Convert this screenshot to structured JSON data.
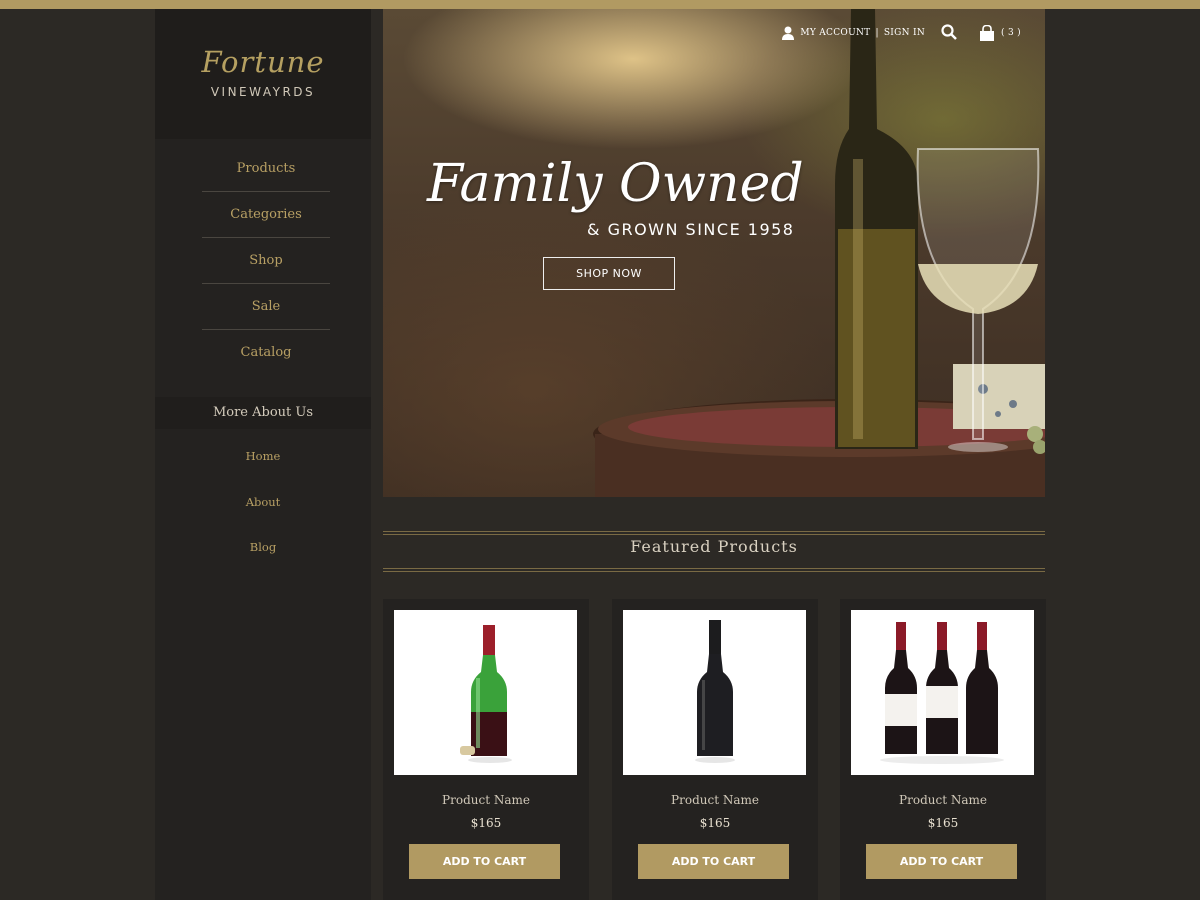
{
  "brand": {
    "script": "Fortune",
    "sub": "VINEWAYRDS"
  },
  "nav": [
    "Products",
    "Categories",
    "Shop",
    "Sale",
    "Catalog"
  ],
  "more": {
    "title": "More About Us",
    "items": [
      "Home",
      "About",
      "Blog"
    ]
  },
  "header": {
    "account": "MY ACCOUNT",
    "separator": "|",
    "signin": "SIGN IN",
    "cart_count": "( 3 )"
  },
  "hero": {
    "title": "Family Owned",
    "subtitle": "& GROWN SINCE 1958",
    "cta": "SHOP NOW"
  },
  "featured": {
    "title": "Featured Products"
  },
  "products": [
    {
      "name": "Product Name",
      "price": "$165",
      "button": "ADD TO CART",
      "image": "green-wine-bottle-with-cork"
    },
    {
      "name": "Product Name",
      "price": "$165",
      "button": "ADD TO CART",
      "image": "dark-wine-bottle"
    },
    {
      "name": "Product Name",
      "price": "$165",
      "button": "ADD TO CART",
      "image": "three-red-wine-bottles"
    }
  ],
  "colors": {
    "accent": "#b19a62",
    "background": "#2c2925",
    "sidebar": "#242220"
  }
}
